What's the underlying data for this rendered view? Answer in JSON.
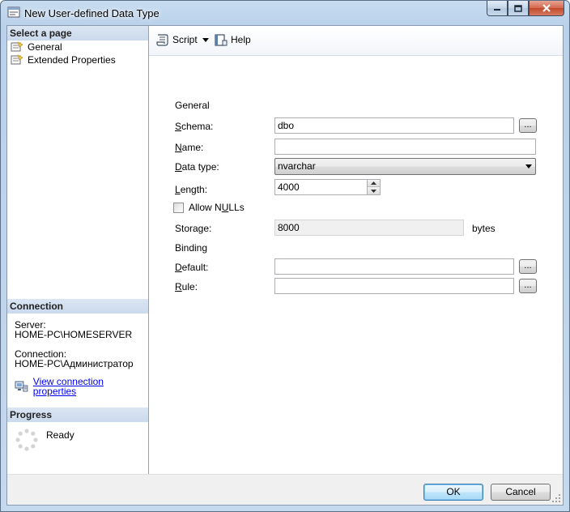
{
  "window": {
    "title": "New User-defined Data Type"
  },
  "left": {
    "select_page_header": "Select a page",
    "pages": [
      {
        "label": "General"
      },
      {
        "label": "Extended Properties"
      }
    ],
    "connection_header": "Connection",
    "server_label": "Server:",
    "server_value": "HOME-PC\\HOMESERVER",
    "connection_label": "Connection:",
    "connection_value": "HOME-PC\\Администратор",
    "view_connection_link": "View connection properties",
    "progress_header": "Progress",
    "progress_status": "Ready"
  },
  "toolbar": {
    "script_label": "Script",
    "help_label": "Help"
  },
  "form": {
    "general_group": "General",
    "schema_label_key": "S",
    "schema_label_rest": "chema:",
    "schema_value": "dbo",
    "name_label_key": "N",
    "name_label_rest": "ame:",
    "name_value": "",
    "datatype_label_key": "D",
    "datatype_label_rest": "ata type:",
    "datatype_value": "nvarchar",
    "length_label_key": "L",
    "length_label_rest": "ength:",
    "length_value": "4000",
    "allow_nulls_pre": "Allow N",
    "allow_nulls_key": "U",
    "allow_nulls_post": "LLs",
    "allow_nulls_checked": false,
    "storage_label": "Storage:",
    "storage_value": "8000",
    "storage_unit": "bytes",
    "binding_group": "Binding",
    "default_label_key": "D",
    "default_label_rest": "efault:",
    "default_value": "",
    "rule_label_key": "R",
    "rule_label_rest": "ule:",
    "rule_value": "",
    "ellipsis": "..."
  },
  "footer": {
    "ok_label": "OK",
    "cancel_label": "Cancel"
  },
  "colors": {
    "link": "#0000ee",
    "section_header_bg": "#cad9ec",
    "close_button": "#c24a2c"
  }
}
